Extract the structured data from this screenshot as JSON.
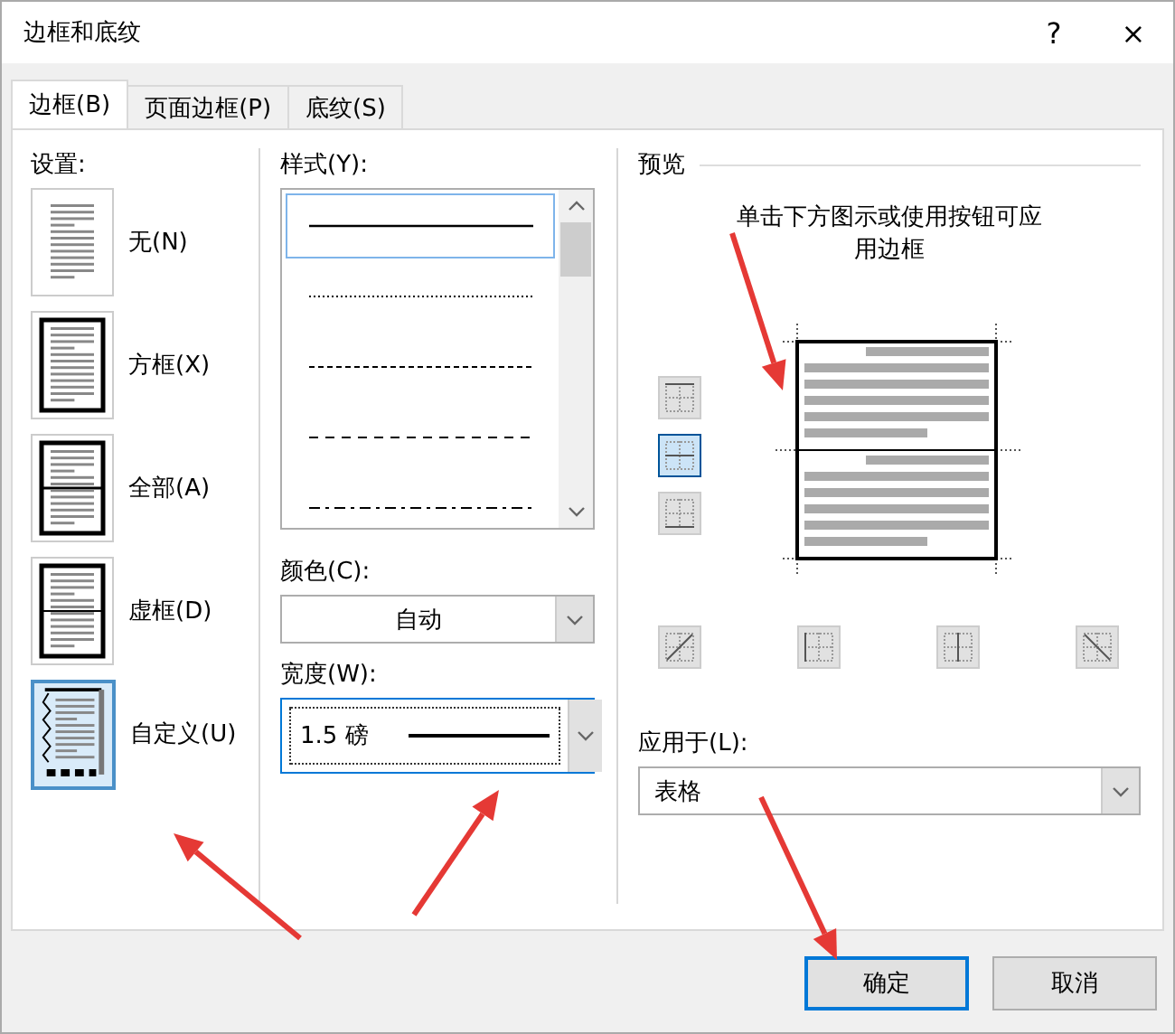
{
  "window": {
    "title": "边框和底纹",
    "help": "?",
    "close": "×"
  },
  "tabs": [
    {
      "label": "边框(B)",
      "selected": true
    },
    {
      "label": "页面边框(P)",
      "selected": false
    },
    {
      "label": "底纹(S)",
      "selected": false
    }
  ],
  "settings": {
    "label": "设置:",
    "items": [
      {
        "kind": "none",
        "label": "无(N)",
        "selected": false
      },
      {
        "kind": "box",
        "label": "方框(X)",
        "selected": false
      },
      {
        "kind": "all",
        "label": "全部(A)",
        "selected": false
      },
      {
        "kind": "grid",
        "label": "虚框(D)",
        "selected": false
      },
      {
        "kind": "custom",
        "label": "自定义(U)",
        "selected": true
      }
    ]
  },
  "style": {
    "label": "样式(Y):",
    "items": [
      {
        "kind": "solid",
        "selected": true
      },
      {
        "kind": "dotted",
        "selected": false
      },
      {
        "kind": "dashed",
        "selected": false
      },
      {
        "kind": "longdash",
        "selected": false
      },
      {
        "kind": "dashdot",
        "selected": false
      }
    ]
  },
  "color": {
    "label": "颜色(C):",
    "value": "自动"
  },
  "width": {
    "label": "宽度(W):",
    "value": "1.5 磅"
  },
  "preview": {
    "label": "预览",
    "hint": "单击下方图示或使用按钮可应用边框",
    "side_buttons": [
      {
        "kind": "top",
        "selected": false
      },
      {
        "kind": "inside-h",
        "selected": true
      },
      {
        "kind": "bottom",
        "selected": false
      }
    ],
    "bottom_buttons": [
      {
        "kind": "diag-up",
        "selected": false
      },
      {
        "kind": "left",
        "selected": false
      },
      {
        "kind": "inside-v",
        "selected": false
      },
      {
        "kind": "diag-down",
        "selected": false
      }
    ]
  },
  "apply_to": {
    "label": "应用于(L):",
    "value": "表格"
  },
  "buttons": [
    {
      "label": "确定",
      "default": true
    },
    {
      "label": "取消",
      "default": false
    }
  ]
}
